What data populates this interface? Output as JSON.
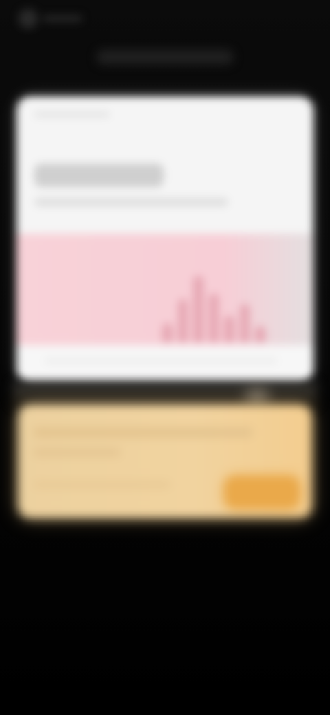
{
  "colors": {
    "background": "#000000",
    "preview_card": "#f5f5f5",
    "preview_accent_pink": "#f8d2d8",
    "chart_bar": "#e6a7b3",
    "offer_card": "#f1d39f",
    "offer_cta": "#eaa94a"
  },
  "icons": {
    "app_logo": "app-logo-icon"
  },
  "preview": {
    "chart_bars": [
      0.26,
      0.58,
      0.9,
      0.66,
      0.36,
      0.52,
      0.22
    ]
  }
}
